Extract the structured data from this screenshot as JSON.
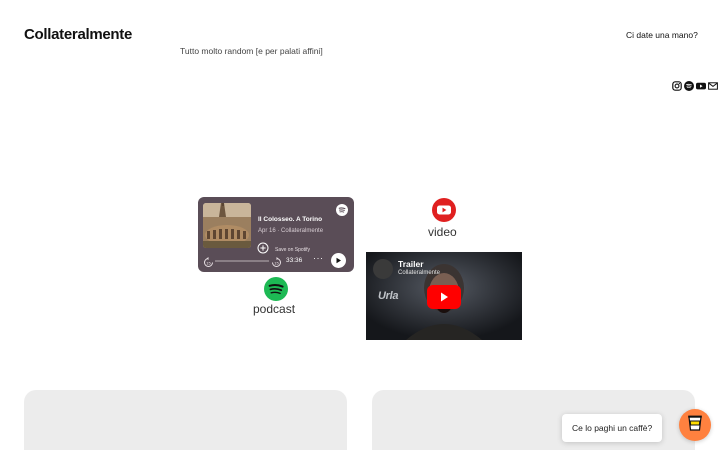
{
  "site": {
    "title": "Collateralmente",
    "tagline": "Tutto molto random [e per palati affini]",
    "nav_link": "Ci date una mano?"
  },
  "social": [
    "instagram-icon",
    "spotify-icon",
    "youtube-icon",
    "email-icon"
  ],
  "spotify_embed": {
    "episode_title": "Il Colosseo. A Torino",
    "meta": "Apr 16 · Collateralmente",
    "save_label": "Save on Spotify",
    "duration": "33:36",
    "rewind_seconds": "15",
    "forward_seconds": "15",
    "more": "···",
    "card_color": "#5a4d57"
  },
  "podcast_label": "podcast",
  "video_label": "video",
  "youtube_embed": {
    "title": "Trailer",
    "channel": "Collateralmente",
    "brand_text": "Urla"
  },
  "coffee": {
    "label": "Ce lo paghi un caffè?",
    "accent": "#ff813f"
  },
  "colors": {
    "spotify_green": "#1db954",
    "youtube_red": "#ff0000",
    "placeholder_gray": "#ececec"
  }
}
